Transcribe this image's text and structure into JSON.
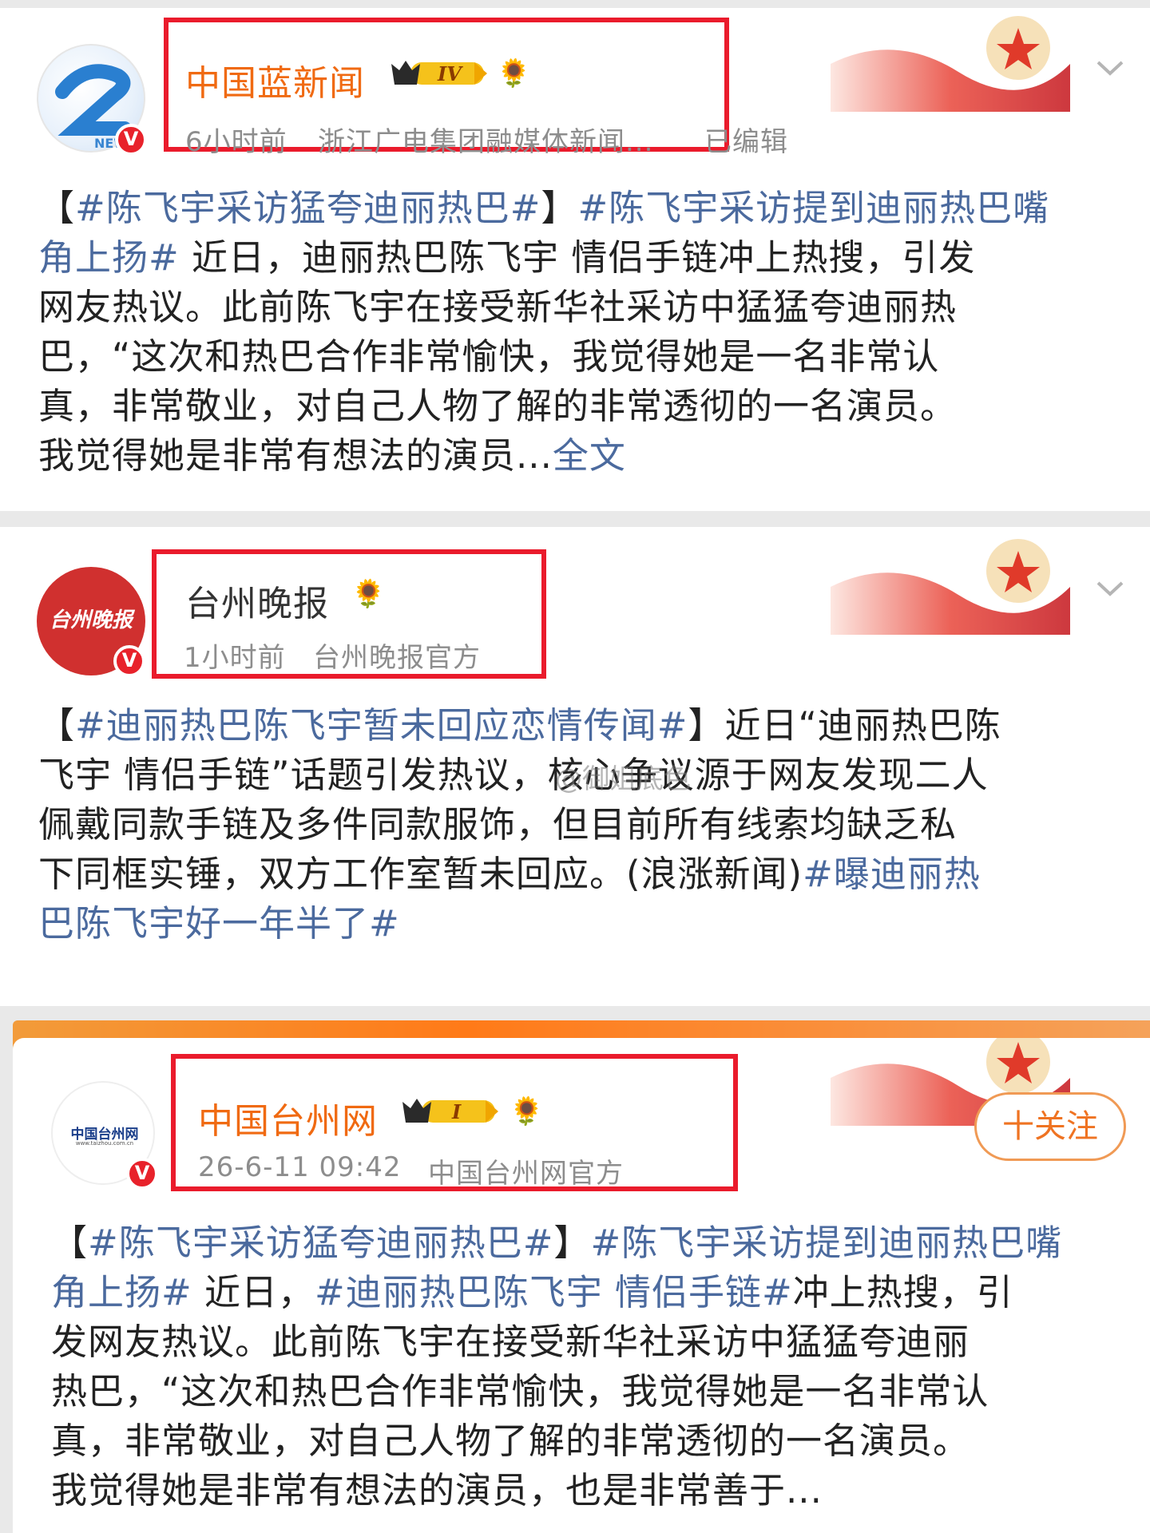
{
  "posts": [
    {
      "name": "中国蓝新闻",
      "level": "IV",
      "meta_time": "6小时前",
      "meta_source": "浙江广电集团融媒体新闻...",
      "meta_edit": "已编辑",
      "avatar_icon": "news-logo-icon",
      "verified_mark": "V",
      "lines": [
        [
          {
            "t": "【",
            "tag": false
          },
          {
            "t": "#陈飞宇采访猛夸迪丽热巴#",
            "tag": true
          },
          {
            "t": "】",
            "tag": false
          },
          {
            "t": "#陈飞宇采访提到迪丽热巴嘴",
            "tag": true
          }
        ],
        [
          {
            "t": "角上扬#",
            "tag": true
          },
          {
            "t": " 近日，迪丽热巴陈飞宇 情侣手链冲上热搜，引发",
            "tag": false
          }
        ],
        [
          {
            "t": "网友热议。此前陈飞宇在接受新华社采访中猛猛夸迪丽热",
            "tag": false
          }
        ],
        [
          {
            "t": "巴，“这次和热巴合作非常愉快，我觉得她是一名非常认",
            "tag": false
          }
        ],
        [
          {
            "t": "真，非常敬业，对自己人物了解的非常透彻的一名演员。",
            "tag": false
          }
        ],
        [
          {
            "t": "我觉得她是非常有想法的演员...",
            "tag": false
          },
          {
            "t": "全文",
            "tag": true
          }
        ]
      ]
    },
    {
      "name": "台州晚报",
      "meta_time": "1小时前",
      "meta_source": "台州晚报官方",
      "avatar_text": "台州晚报",
      "verified_mark": "V",
      "lines": [
        [
          {
            "t": "【",
            "tag": false
          },
          {
            "t": "#迪丽热巴陈飞宇暂未回应恋情传闻#",
            "tag": true
          },
          {
            "t": "】近日“迪丽热巴陈",
            "tag": false
          }
        ],
        [
          {
            "t": "飞宇 情侣手链”话题引发热议，核心争议源于网友发现二人",
            "tag": false
          }
        ],
        [
          {
            "t": "佩戴同款手链及多件同款服饰，但目前所有线索均缺乏私",
            "tag": false
          }
        ],
        [
          {
            "t": "下同框实锤，双方工作室暂未回应。(浪涨新闻)",
            "tag": false
          },
          {
            "t": "#曝迪丽热",
            "tag": true
          }
        ],
        [
          {
            "t": "巴陈飞宇好一年半了#",
            "tag": true
          }
        ]
      ]
    },
    {
      "name": "中国台州网",
      "level": "I",
      "meta_time": "26-6-11 09:42",
      "meta_source": "中国台州网官方",
      "avatar_text": "中国台州网",
      "avatar_sub": "www.taizhou.com.cn",
      "verified_mark": "V",
      "follow_label": "十关注",
      "lines": [
        [
          {
            "t": "【",
            "tag": false
          },
          {
            "t": "#陈飞宇采访猛夸迪丽热巴#",
            "tag": true
          },
          {
            "t": "】",
            "tag": false
          },
          {
            "t": "#陈飞宇采访提到迪丽热巴嘴",
            "tag": true
          }
        ],
        [
          {
            "t": "角上扬#",
            "tag": true
          },
          {
            "t": " 近日，",
            "tag": false
          },
          {
            "t": "#迪丽热巴陈飞宇 情侣手链#",
            "tag": true
          },
          {
            "t": "冲上热搜，引",
            "tag": false
          }
        ],
        [
          {
            "t": "发网友热议。此前陈飞宇在接受新华社采访中猛猛夸迪丽",
            "tag": false
          }
        ],
        [
          {
            "t": "热巴，“这次和热巴合作非常愉快，我觉得她是一名非常认",
            "tag": false
          }
        ],
        [
          {
            "t": "真，非常敬业，对自己人物了解的非常透彻的一名演员。",
            "tag": false
          }
        ],
        [
          {
            "t": "我觉得她是非常有想法的演员，也是非常善于...",
            "tag": false
          }
        ]
      ]
    }
  ],
  "watermark": "@御姐底色",
  "colors": {
    "orange_name": "#f06a12",
    "tag_blue": "#4b6a9e",
    "highlight_red": "#ea1b2c"
  }
}
